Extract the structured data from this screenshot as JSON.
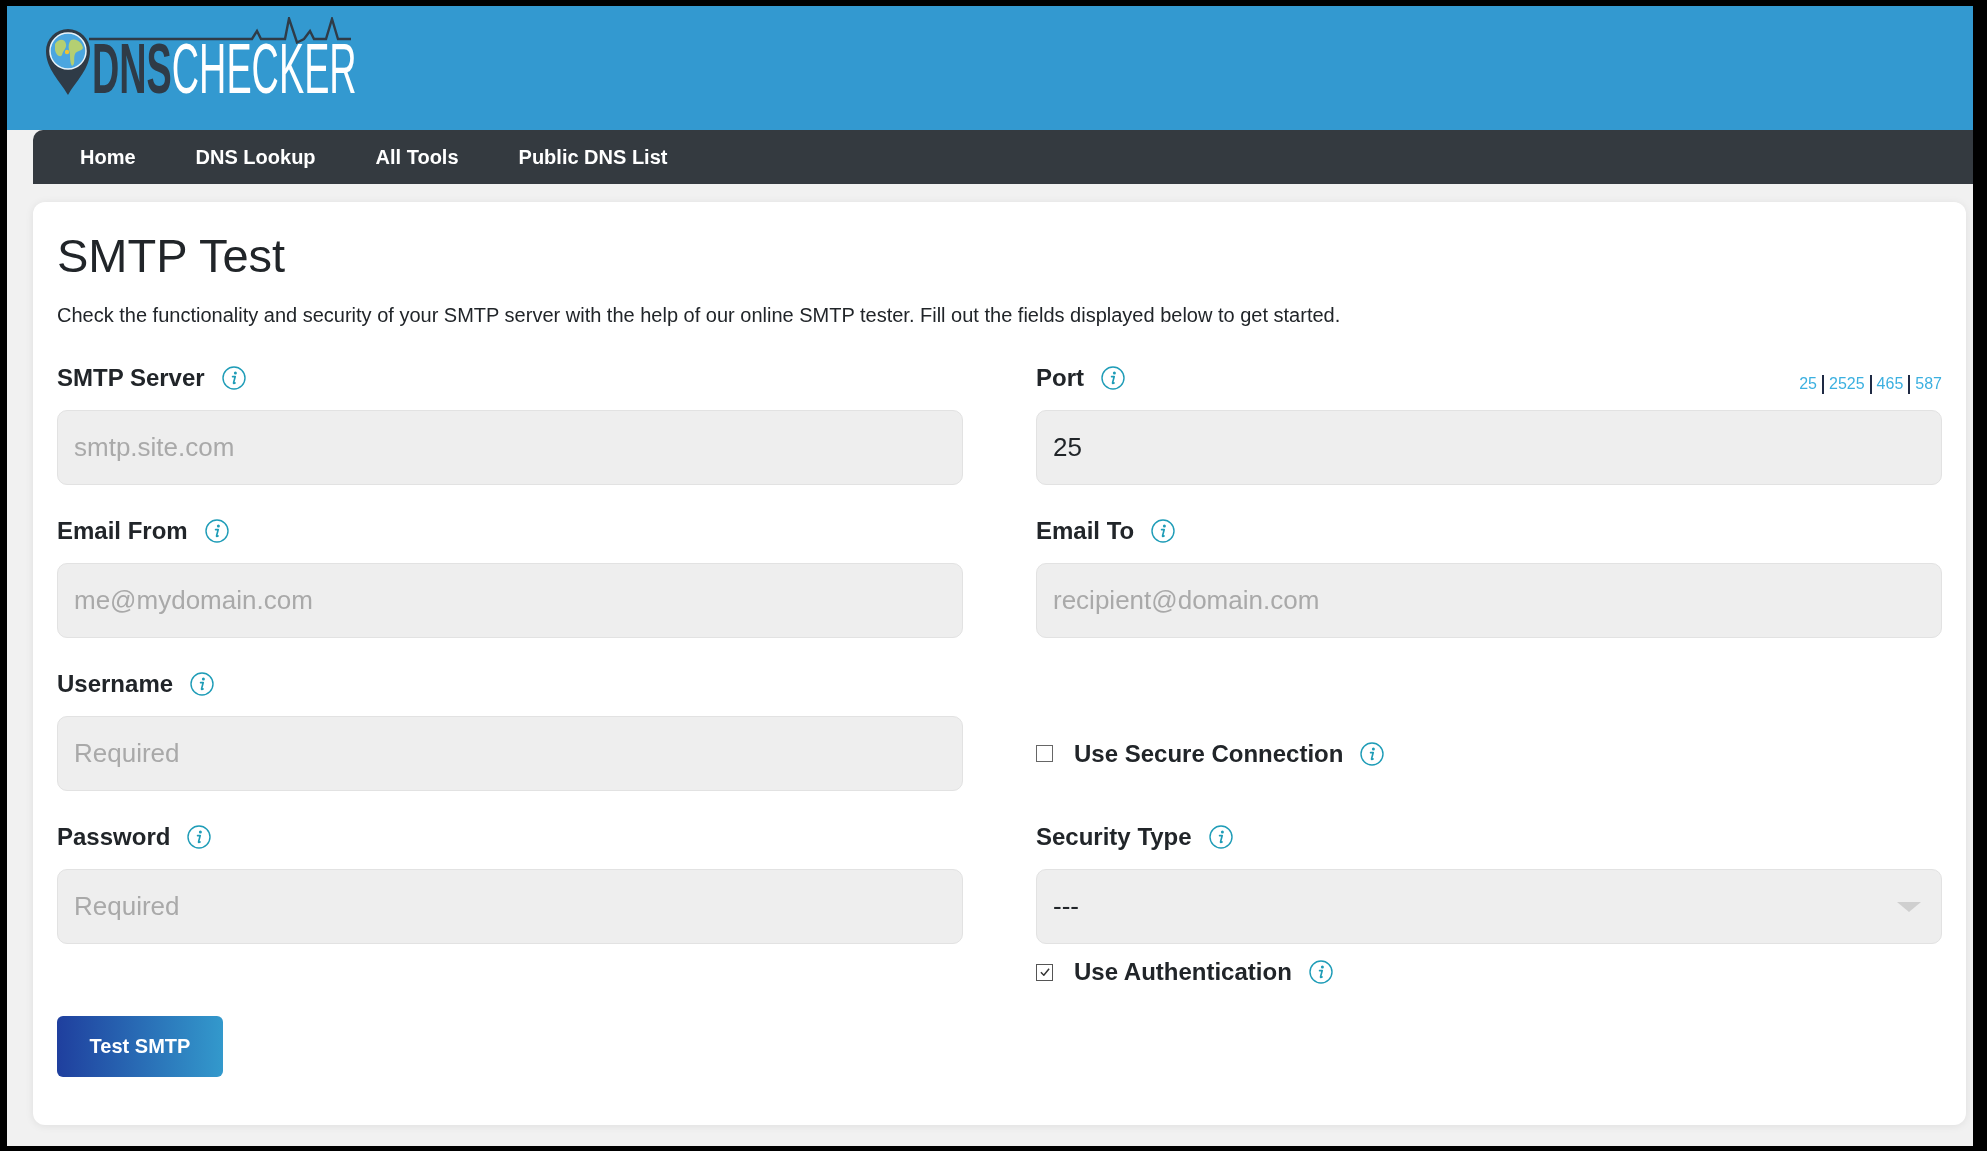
{
  "header": {
    "logo": "**DNS**CHECKER"
  },
  "nav": [
    "Home",
    "DNS Lookup",
    "All Tools",
    "Public DNS List"
  ],
  "page": {
    "title": "SMTP Test",
    "description": "Check the functionality and security of your SMTP server with the help of our online SMTP tester. Fill out the fields displayed below to get started."
  },
  "form": {
    "rows": [
      {
        "left": [
          {
            "kind": "input",
            "label": "SMTP Server",
            "placeholder": "smtp.site.com"
          }
        ],
        "right": [
          {
            "kind": "input",
            "label": "Port",
            "value": "25",
            "quick_values": [
              "25",
              "2525",
              "465",
              "587"
            ]
          }
        ]
      },
      {
        "left": [
          {
            "kind": "input",
            "label": "Email From",
            "placeholder": "me@mydomain.com"
          }
        ],
        "right": [
          {
            "kind": "input",
            "label": "Email To",
            "placeholder": "recipient@domain.com"
          }
        ]
      },
      {
        "left": [
          {
            "kind": "input",
            "label": "Username",
            "placeholder": "Required"
          }
        ],
        "right": [
          {
            "kind": "checkbox",
            "label": "Use Secure Connection",
            "checked": false
          }
        ]
      },
      {
        "left": [
          {
            "kind": "input",
            "label": "Password",
            "placeholder": "Required"
          }
        ],
        "right": [
          {
            "kind": "select",
            "label": "Security Type",
            "value": "---"
          },
          {
            "kind": "checkbox",
            "label": "Use Authentication",
            "checked": true
          }
        ]
      }
    ],
    "submit_button": "Test SMTP"
  }
}
